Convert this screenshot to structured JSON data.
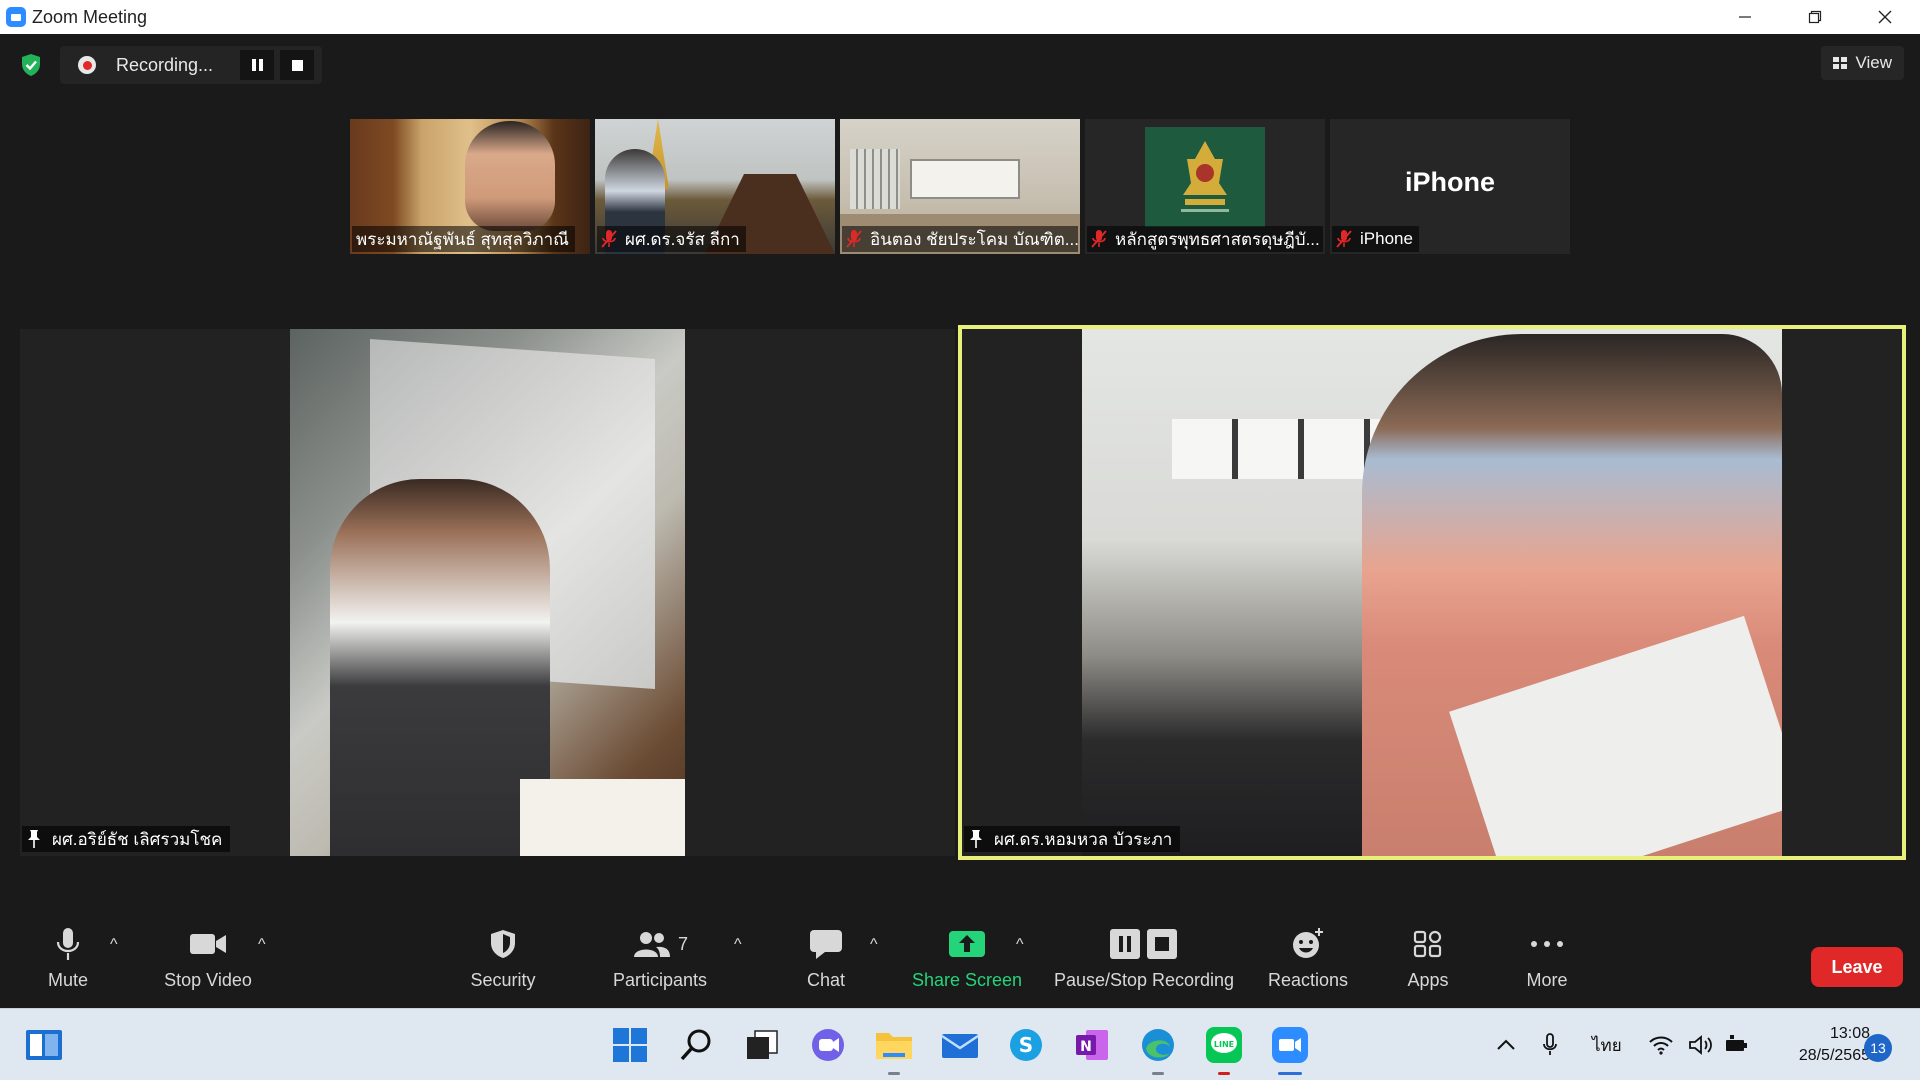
{
  "window": {
    "title": "Zoom Meeting"
  },
  "recording": {
    "status": "Recording..."
  },
  "view_label": "View",
  "thumbnails": [
    {
      "name": "พระมหาณัฐพันธ์ สุทสุลวิภาณี",
      "muted": false
    },
    {
      "name": "ผศ.ดร.จรัส ลีกา",
      "muted": true
    },
    {
      "name": "อินตอง ชัยประโคม บัณฑิต...",
      "muted": true
    },
    {
      "name": "หลักสูตรพุทธศาสตรดุษฎีบั...",
      "muted": true
    },
    {
      "name": "iPhone",
      "muted": true,
      "display_name": "iPhone"
    }
  ],
  "main_videos": [
    {
      "name": "ผศ.อริย์ธัช เลิศรวมโชค",
      "pinned": true
    },
    {
      "name": "ผศ.ดร.หอมหวล บัวระภา",
      "pinned": true,
      "active_speaker": true
    }
  ],
  "toolbar": {
    "mute": "Mute",
    "stop_video": "Stop Video",
    "security": "Security",
    "participants": "Participants",
    "participant_count": "7",
    "chat": "Chat",
    "share_screen": "Share Screen",
    "pause_stop_recording": "Pause/Stop Recording",
    "reactions": "Reactions",
    "apps": "Apps",
    "more": "More",
    "leave": "Leave"
  },
  "taskbar": {
    "language": "ไทย",
    "time": "13:08",
    "date": "28/5/2565",
    "notification_count": "13"
  },
  "colors": {
    "zoom_blue": "#2d8cff",
    "active_border": "#e8f07a",
    "share_green": "#25d37a",
    "leave_red": "#e02828"
  }
}
